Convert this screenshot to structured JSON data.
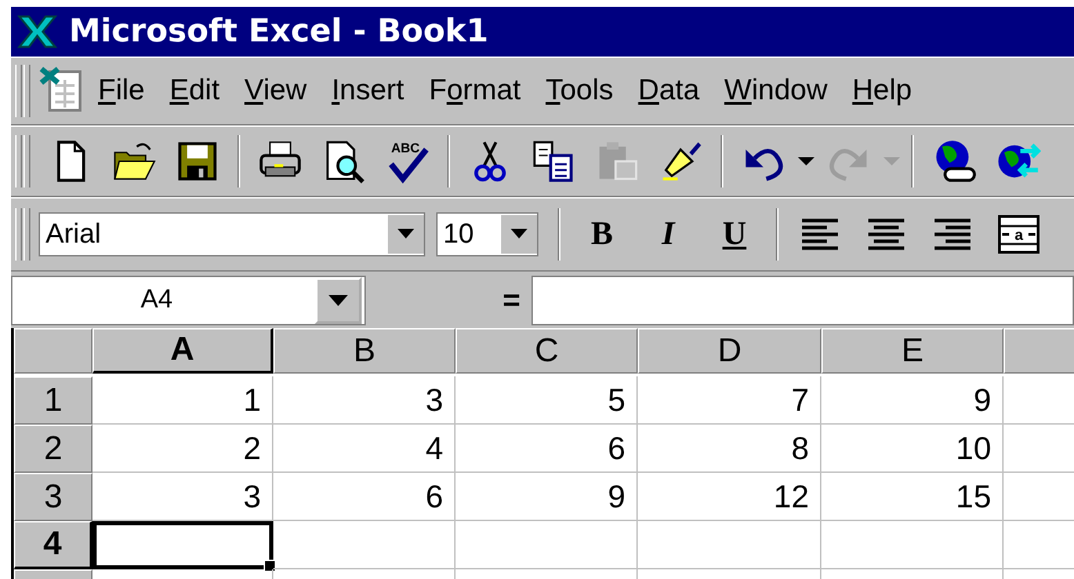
{
  "window": {
    "title": "Microsoft Excel - Book1"
  },
  "menu": [
    {
      "access_key": "F",
      "suffix": "ile"
    },
    {
      "access_key": "E",
      "suffix": "dit"
    },
    {
      "access_key": "V",
      "suffix": "iew"
    },
    {
      "access_key": "I",
      "suffix": "nsert"
    },
    {
      "prefix": "F",
      "access_key": "o",
      "suffix": "rmat"
    },
    {
      "access_key": "T",
      "suffix": "ools"
    },
    {
      "access_key": "D",
      "suffix": "ata"
    },
    {
      "access_key": "W",
      "suffix": "indow"
    },
    {
      "access_key": "H",
      "suffix": "elp"
    }
  ],
  "standard_toolbar": [
    {
      "kind": "new",
      "disabled": false
    },
    {
      "kind": "open",
      "disabled": false
    },
    {
      "kind": "save",
      "disabled": false
    },
    {
      "kind": "separator"
    },
    {
      "kind": "print",
      "disabled": false
    },
    {
      "kind": "preview",
      "disabled": false
    },
    {
      "kind": "spelling",
      "disabled": false,
      "text": "ABC"
    },
    {
      "kind": "separator"
    },
    {
      "kind": "cut",
      "disabled": false
    },
    {
      "kind": "copy",
      "disabled": false
    },
    {
      "kind": "paste",
      "disabled": true
    },
    {
      "kind": "brush",
      "disabled": false
    },
    {
      "kind": "separator"
    },
    {
      "kind": "undo",
      "disabled": false
    },
    {
      "kind": "dropdown",
      "disabled": false
    },
    {
      "kind": "redo",
      "disabled": true
    },
    {
      "kind": "dropdown",
      "disabled": true
    },
    {
      "kind": "separator"
    },
    {
      "kind": "globe-link",
      "disabled": false
    },
    {
      "kind": "globe-arrows",
      "disabled": false
    }
  ],
  "format_toolbar": {
    "font": "Arial",
    "size": "10",
    "buttons": [
      {
        "kind": "bold",
        "text": "B"
      },
      {
        "kind": "italic",
        "text": "I"
      },
      {
        "kind": "underline",
        "text": "U"
      },
      {
        "kind": "separator"
      },
      {
        "kind": "align-left"
      },
      {
        "kind": "center"
      },
      {
        "kind": "align-right"
      },
      {
        "kind": "merge",
        "text": "a"
      }
    ]
  },
  "formula_bar": {
    "name_box": "A4",
    "equals": "="
  },
  "sheet": {
    "columns": [
      {
        "label": "A",
        "selected": true
      },
      {
        "label": "B",
        "selected": false
      },
      {
        "label": "C",
        "selected": false
      },
      {
        "label": "D",
        "selected": false
      },
      {
        "label": "E",
        "selected": false
      }
    ],
    "rows": [
      {
        "header": "1",
        "selected": false,
        "cells": [
          "1",
          "3",
          "5",
          "7",
          "9"
        ]
      },
      {
        "header": "2",
        "selected": false,
        "cells": [
          "2",
          "4",
          "6",
          "8",
          "10"
        ]
      },
      {
        "header": "3",
        "selected": false,
        "cells": [
          "3",
          "6",
          "9",
          "12",
          "15"
        ]
      },
      {
        "header": "4",
        "selected": true,
        "cells": []
      }
    ]
  }
}
